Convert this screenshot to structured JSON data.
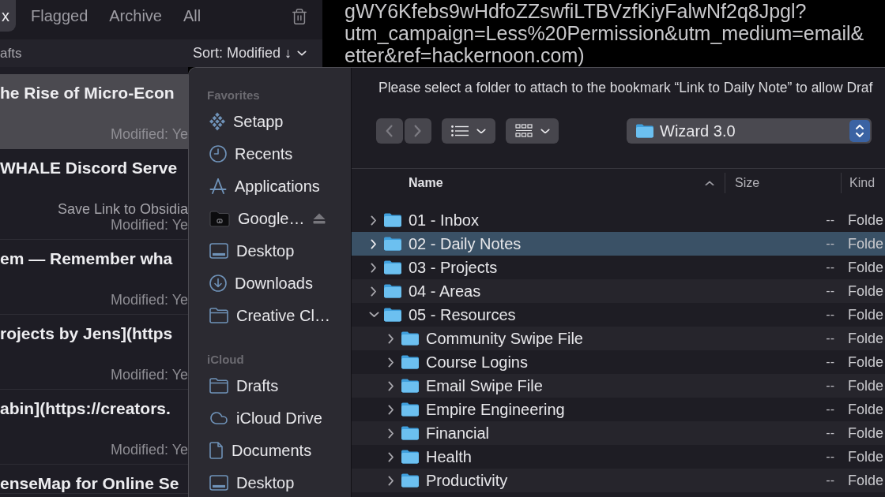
{
  "drafts": {
    "tabs": [
      {
        "label": "x",
        "selected": true
      },
      {
        "label": "Flagged",
        "selected": false
      },
      {
        "label": "Archive",
        "selected": false
      },
      {
        "label": "All",
        "selected": false
      }
    ],
    "folder_label": "afts",
    "sort": "Sort: Modified ↓",
    "notes": [
      {
        "title": "he Rise of Micro-Econ",
        "modified": "Modified: Ye",
        "selected": true
      },
      {
        "title": "WHALE Discord Serve",
        "source": "Save Link to Obsidia",
        "modified": "Modified: Ye",
        "selected": false
      },
      {
        "title": "em — Remember wha",
        "modified": "Modified: Ye",
        "selected": false
      },
      {
        "title": "rojects by Jens](https",
        "modified": "Modified: Ye",
        "selected": false
      },
      {
        "title": "abin](https://creators.",
        "modified": "Modified: Ye",
        "selected": false
      },
      {
        "title": "enseMap for Online Se",
        "selected": false
      }
    ]
  },
  "url_lines": [
    "gWY6Kfebs9wHdfoZZswfiLTBVzfKiyFalwNf2q8Jpgl?",
    "utm_campaign=Less%20Permission&utm_medium=email&",
    "etter&ref=hackernoon.com)"
  ],
  "dialog": {
    "sidebar": [
      {
        "heading": "Favorites",
        "items": [
          {
            "label": "Setapp",
            "kind": "setapp",
            "ejectable": false
          },
          {
            "label": "Recents",
            "kind": "recents",
            "ejectable": false
          },
          {
            "label": "Applications",
            "kind": "applications",
            "ejectable": false
          },
          {
            "label": "Google…",
            "kind": "drive",
            "ejectable": true
          },
          {
            "label": "Desktop",
            "kind": "desktop",
            "ejectable": false
          },
          {
            "label": "Downloads",
            "kind": "downloads",
            "ejectable": false
          },
          {
            "label": "Creative Cl…",
            "kind": "folder",
            "ejectable": false
          }
        ]
      },
      {
        "heading": "iCloud",
        "items": [
          {
            "label": "Drafts",
            "kind": "folder",
            "ejectable": false
          },
          {
            "label": "iCloud Drive",
            "kind": "cloud",
            "ejectable": false
          },
          {
            "label": "Documents",
            "kind": "document",
            "ejectable": false
          },
          {
            "label": "Desktop",
            "kind": "desktop",
            "ejectable": false
          }
        ]
      }
    ],
    "message": "Please select a folder to attach to the bookmark “Link to Daily Note” to allow Draf",
    "nav_buttons": [
      {
        "kind": "back",
        "disabled": true
      },
      {
        "kind": "forward",
        "disabled": true
      }
    ],
    "location": "Wizard 3.0",
    "columns": [
      {
        "label": "Name",
        "sorted": true
      },
      {
        "label": "Size",
        "sorted": false
      },
      {
        "label": "Kind",
        "sorted": false
      }
    ],
    "rows": [
      {
        "name": "01 - Inbox",
        "size": "--",
        "file_kind": "Folde",
        "expanded": false,
        "selected": false
      },
      {
        "name": "02 - Daily Notes",
        "size": "--",
        "file_kind": "Folde",
        "expanded": false,
        "selected": true
      },
      {
        "name": "03 - Projects",
        "size": "--",
        "file_kind": "Folde",
        "expanded": false,
        "selected": false
      },
      {
        "name": "04 - Areas",
        "size": "--",
        "file_kind": "Folde",
        "expanded": false,
        "selected": false
      },
      {
        "name": "05 - Resources",
        "size": "--",
        "file_kind": "Folde",
        "expanded": true,
        "selected": false,
        "children": [
          {
            "name": "Community Swipe File",
            "size": "--",
            "file_kind": "Folde",
            "expanded": false,
            "selected": false
          },
          {
            "name": "Course Logins",
            "size": "--",
            "file_kind": "Folde",
            "expanded": false,
            "selected": false
          },
          {
            "name": "Email Swipe File",
            "size": "--",
            "file_kind": "Folde",
            "expanded": false,
            "selected": false
          },
          {
            "name": "Empire Engineering",
            "size": "--",
            "file_kind": "Folde",
            "expanded": false,
            "selected": false
          },
          {
            "name": "Financial",
            "size": "--",
            "file_kind": "Folde",
            "expanded": false,
            "selected": false
          },
          {
            "name": "Health",
            "size": "--",
            "file_kind": "Folde",
            "expanded": false,
            "selected": false
          },
          {
            "name": "Productivity",
            "size": "--",
            "file_kind": "Folde",
            "expanded": false,
            "selected": false
          }
        ]
      }
    ]
  }
}
